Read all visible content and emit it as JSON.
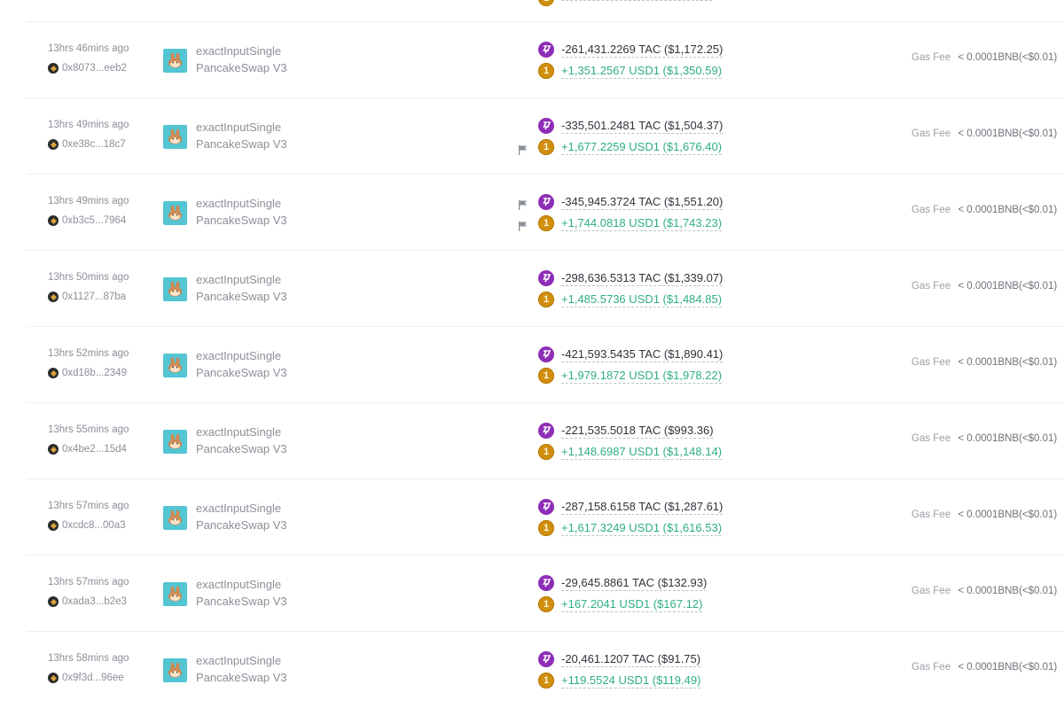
{
  "gas_label": "Gas Fee",
  "rows": [
    {
      "time": "13hrs 46mins ago",
      "address": "0x8073...eeb2",
      "method": "exactInputSingle",
      "dex": "PancakeSwap V3",
      "out": "-261,431.2269 TAC ($1,172.25)",
      "in": "+1,351.2567 USD1 ($1,350.59)",
      "gas": "< 0.0001BNB(<$0.01)",
      "flags": []
    },
    {
      "time": "13hrs 49mins ago",
      "address": "0xe38c...18c7",
      "method": "exactInputSingle",
      "dex": "PancakeSwap V3",
      "out": "-335,501.2481 TAC ($1,504.37)",
      "in": "+1,677.2259 USD1 ($1,676.40)",
      "gas": "< 0.0001BNB(<$0.01)",
      "flags": [
        "in"
      ]
    },
    {
      "time": "13hrs 49mins ago",
      "address": "0xb3c5...7964",
      "method": "exactInputSingle",
      "dex": "PancakeSwap V3",
      "out": "-345,945.3724 TAC ($1,551.20)",
      "in": "+1,744.0818 USD1 ($1,743.23)",
      "gas": "< 0.0001BNB(<$0.01)",
      "flags": [
        "out",
        "in"
      ]
    },
    {
      "time": "13hrs 50mins ago",
      "address": "0x1127...87ba",
      "method": "exactInputSingle",
      "dex": "PancakeSwap V3",
      "out": "-298,636.5313 TAC ($1,339.07)",
      "in": "+1,485.5736 USD1 ($1,484.85)",
      "gas": "< 0.0001BNB(<$0.01)",
      "flags": []
    },
    {
      "time": "13hrs 52mins ago",
      "address": "0xd18b...2349",
      "method": "exactInputSingle",
      "dex": "PancakeSwap V3",
      "out": "-421,593.5435 TAC ($1,890.41)",
      "in": "+1,979.1872 USD1 ($1,978.22)",
      "gas": "< 0.0001BNB(<$0.01)",
      "flags": []
    },
    {
      "time": "13hrs 55mins ago",
      "address": "0x4be2...15d4",
      "method": "exactInputSingle",
      "dex": "PancakeSwap V3",
      "out": "-221,535.5018 TAC ($993.36)",
      "in": "+1,148.6987 USD1 ($1,148.14)",
      "gas": "< 0.0001BNB(<$0.01)",
      "flags": []
    },
    {
      "time": "13hrs 57mins ago",
      "address": "0xcdc8...00a3",
      "method": "exactInputSingle",
      "dex": "PancakeSwap V3",
      "out": "-287,158.6158 TAC ($1,287.61)",
      "in": "+1,617.3249 USD1 ($1,616.53)",
      "gas": "< 0.0001BNB(<$0.01)",
      "flags": []
    },
    {
      "time": "13hrs 57mins ago",
      "address": "0xada3...b2e3",
      "method": "exactInputSingle",
      "dex": "PancakeSwap V3",
      "out": "-29,645.8861 TAC ($132.93)",
      "in": "+167.2041 USD1 ($167.12)",
      "gas": "< 0.0001BNB(<$0.01)",
      "flags": []
    },
    {
      "time": "13hrs 58mins ago",
      "address": "0x9f3d...96ee",
      "method": "exactInputSingle",
      "dex": "PancakeSwap V3",
      "out": "-20,461.1207 TAC ($91.75)",
      "in": "+119.5524 USD1 ($119.49)",
      "gas": "< 0.0001BNB(<$0.01)",
      "flags": []
    }
  ]
}
